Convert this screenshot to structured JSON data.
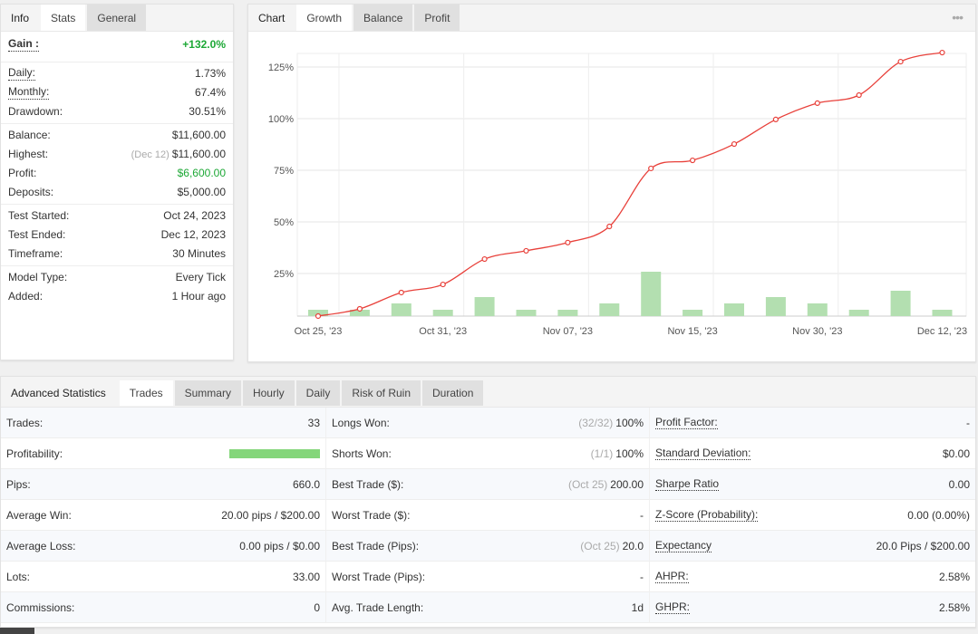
{
  "left": {
    "tabs": [
      "Info",
      "Stats",
      "General"
    ],
    "gain": {
      "label": "Gain :",
      "value": "+132.0%"
    },
    "groups": [
      [
        {
          "label": "Daily:",
          "value": "1.73%",
          "dot": true
        },
        {
          "label": "Monthly:",
          "value": "67.4%",
          "dot": true
        },
        {
          "label": "Drawdown:",
          "value": "30.51%"
        }
      ],
      [
        {
          "label": "Balance:",
          "value": "$11,600.00"
        },
        {
          "label": "Highest:",
          "note": "(Dec 12)",
          "value": "$11,600.00"
        },
        {
          "label": "Profit:",
          "value": "$6,600.00",
          "green": true
        },
        {
          "label": "Deposits:",
          "value": "$5,000.00"
        }
      ],
      [
        {
          "label": "Test Started:",
          "value": "Oct 24, 2023"
        },
        {
          "label": "Test Ended:",
          "value": "Dec 12, 2023"
        },
        {
          "label": "Timeframe:",
          "value": "30 Minutes"
        }
      ],
      [
        {
          "label": "Model Type:",
          "value": "Every Tick"
        },
        {
          "label": "Added:",
          "value": "1 Hour ago"
        }
      ]
    ]
  },
  "chart_panel": {
    "tabs": [
      "Chart",
      "Growth",
      "Balance",
      "Profit"
    ],
    "menu": "•••"
  },
  "chart_data": {
    "type": "line",
    "title": "Growth",
    "x": [
      "Oct 25, '23",
      "",
      "",
      "Oct 31, '23",
      "",
      "",
      "Nov 07, '23",
      "",
      "",
      "Nov 15, '23",
      "",
      "",
      "Nov 30, '23",
      "",
      "",
      "Dec 12, '23"
    ],
    "series": [
      {
        "name": "Growth %",
        "type": "line",
        "color": "#e8403a",
        "values": [
          4.4,
          7.9,
          15.8,
          19.7,
          32,
          36,
          40,
          47.8,
          75.9,
          79.8,
          87.7,
          99.6,
          107.5,
          111.4,
          127.6,
          132
        ]
      },
      {
        "name": "Trades",
        "type": "bar",
        "color": "#b3dfb0",
        "values": [
          1,
          1,
          2,
          1,
          3,
          1,
          1,
          2,
          7,
          1,
          2,
          3,
          2,
          1,
          4,
          1
        ]
      }
    ],
    "yticks": [
      "25%",
      "50%",
      "75%",
      "100%",
      "125%"
    ],
    "ylim": [
      0,
      140
    ],
    "grid": true
  },
  "bottom": {
    "tabs": [
      "Advanced Statistics",
      "Trades",
      "Summary",
      "Hourly",
      "Daily",
      "Risk of Ruin",
      "Duration"
    ],
    "profitability": 1.0,
    "rows": [
      [
        {
          "label": "Trades:",
          "value": "33"
        },
        {
          "label": "Longs Won:",
          "note": "(32/32)",
          "value": "100%"
        },
        {
          "label": "Profit Factor:",
          "value": "-"
        }
      ],
      [
        {
          "label": "Profitability:",
          "value": ""
        },
        {
          "label": "Shorts Won:",
          "note": "(1/1)",
          "value": "100%"
        },
        {
          "label": "Standard Deviation:",
          "value": "$0.00"
        }
      ],
      [
        {
          "label": "Pips:",
          "value": "660.0"
        },
        {
          "label": "Best Trade ($):",
          "note": "(Oct 25)",
          "value": "200.00"
        },
        {
          "label": "Sharpe Ratio",
          "value": "0.00"
        }
      ],
      [
        {
          "label": "Average Win:",
          "value": "20.00 pips / $200.00"
        },
        {
          "label": "Worst Trade ($):",
          "value": "-"
        },
        {
          "label": "Z-Score (Probability):",
          "value": "0.00 (0.00%)"
        }
      ],
      [
        {
          "label": "Average Loss:",
          "value": "0.00 pips / $0.00"
        },
        {
          "label": "Best Trade (Pips):",
          "note": "(Oct 25)",
          "value": "20.0"
        },
        {
          "label": "Expectancy",
          "value": "20.0 Pips / $200.00"
        }
      ],
      [
        {
          "label": "Lots:",
          "value": "33.00"
        },
        {
          "label": "Worst Trade (Pips):",
          "value": "-"
        },
        {
          "label": "AHPR:",
          "value": "2.58%"
        }
      ],
      [
        {
          "label": "Commissions:",
          "value": "0"
        },
        {
          "label": "Avg. Trade Length:",
          "value": "1d"
        },
        {
          "label": "GHPR:",
          "value": "2.58%"
        }
      ]
    ]
  }
}
